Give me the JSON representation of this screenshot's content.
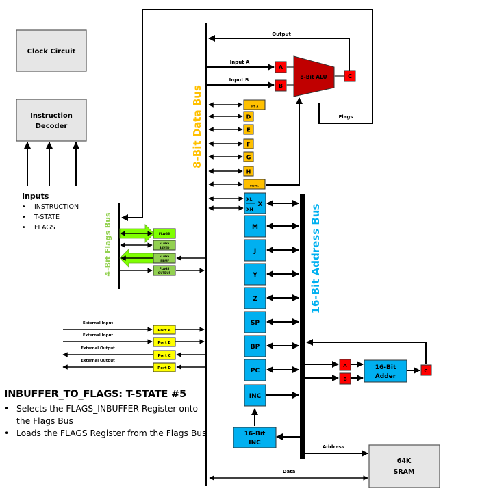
{
  "colors": {
    "gray_box": "#e6e6e6",
    "register_blue": "#00b0f0",
    "register_orange": "#ffc000",
    "alu_red": "#c00000",
    "latch_red": "#ff0000",
    "flags_green": "#92d050",
    "flags_bright_green": "#7fff00",
    "port_yellow": "#ffff00",
    "data_bus_label": "#ffc000",
    "address_bus_label": "#00b0f0",
    "flags_bus_label": "#92d050"
  },
  "control": {
    "clock": "Clock Circuit",
    "decoder_line1": "Instruction",
    "decoder_line2": "Decoder",
    "inputs_title": "Inputs",
    "inputs": [
      "INSTRUCTION",
      "T-STATE",
      "FLAGS"
    ]
  },
  "buses": {
    "data_bus": "8-Bit Data Bus",
    "address_bus": "16-Bit Address Bus",
    "flags_bus": "4-Bit Flags Bus"
  },
  "alu": {
    "label": "8-Bit ALU",
    "input_a": "Input A",
    "input_b": "Input B",
    "output": "Output",
    "flags": "Flags",
    "reg_a": "A",
    "reg_b": "B",
    "reg_c": "C"
  },
  "registers_8bit": [
    "INT. A",
    "D",
    "E",
    "F",
    "G",
    "H",
    "INSTR."
  ],
  "registers_16bit": {
    "x_low": "XL",
    "x_high": "XH",
    "x": "X",
    "others": [
      "M",
      "J",
      "Y",
      "Z",
      "SP",
      "BP",
      "PC",
      "INC"
    ]
  },
  "flags_registers": [
    {
      "line1": "FLAGS",
      "line2": ""
    },
    {
      "line1": "FLAGS",
      "line2": "SAVED"
    },
    {
      "line1": "FLAGS",
      "line2": "INBUF"
    },
    {
      "line1": "FLAGS",
      "line2": "OUTBUF"
    }
  ],
  "ports": [
    {
      "name": "Port A",
      "label": "External Input"
    },
    {
      "name": "Port B",
      "label": "External Input"
    },
    {
      "name": "Port C",
      "label": "External Output"
    },
    {
      "name": "Port D",
      "label": "External Output"
    }
  ],
  "adder": {
    "line1": "16-Bit",
    "line2": "Adder",
    "reg_a": "A",
    "reg_b": "B",
    "reg_c": "C"
  },
  "incrementer": {
    "line1": "16-Bit",
    "line2": "INC"
  },
  "memory": {
    "line1": "64K",
    "line2": "SRAM",
    "address": "Address",
    "data": "Data"
  },
  "description": {
    "title": "INBUFFER_TO_FLAGS: T-STATE #5",
    "bullets": [
      "Selects the FLAGS_INBUFFER Register onto the Flags Bus",
      "Loads the FLAGS Register from the Flags Bus"
    ]
  }
}
